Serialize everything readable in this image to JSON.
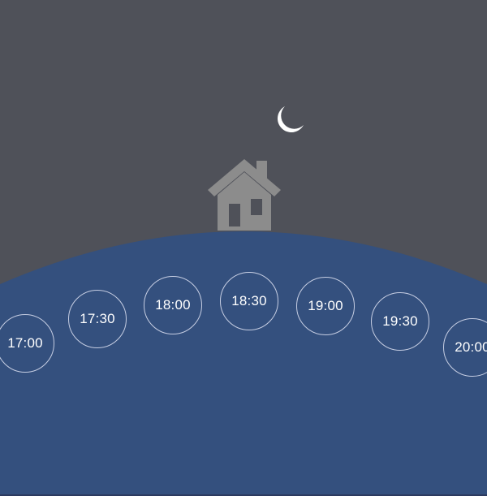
{
  "scene": {
    "sky_color": "#4f5159",
    "hill_color": "#34507e",
    "moon_icon": "crescent-moon",
    "moon_color": "#ffffff",
    "home_icon": "house",
    "home_color": "#8c8c8c"
  },
  "time_slots": [
    {
      "label": "17:00"
    },
    {
      "label": "17:30"
    },
    {
      "label": "18:00"
    },
    {
      "label": "18:30"
    },
    {
      "label": "19:00"
    },
    {
      "label": "19:30"
    },
    {
      "label": "20:00"
    }
  ]
}
